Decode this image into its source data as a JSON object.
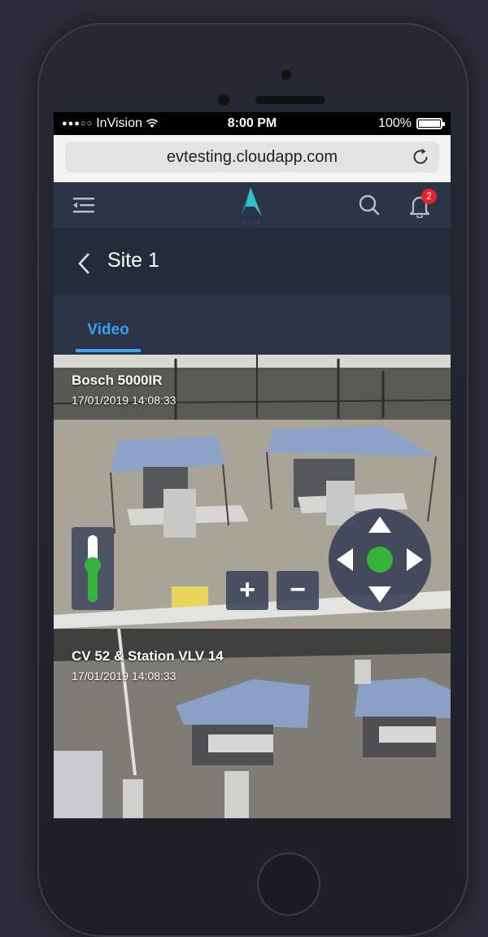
{
  "status_bar": {
    "carrier": "InVision",
    "time": "8:00 PM",
    "battery": "100%"
  },
  "browser": {
    "url": "evtesting.cloudapp.com"
  },
  "app_header": {
    "logo_text": "ALIS",
    "notification_count": "2"
  },
  "page": {
    "title": "Site 1"
  },
  "tabs": [
    {
      "label": "Video",
      "active": true
    }
  ],
  "cameras": [
    {
      "name": "Bosch 5000IR",
      "timestamp": "17/01/2019 14:08:33",
      "controls": {
        "zoom_level": 0.55,
        "zoom_in_label": "+",
        "zoom_out_label": "−"
      }
    },
    {
      "name": "CV 52 & Station VLV 14",
      "timestamp": "17/01/2019 14:08:33"
    }
  ],
  "colors": {
    "accent": "#3aa1ee",
    "header_bg": "#2a3446",
    "page_header_bg": "#232c3b",
    "control_green": "#35b43c",
    "badge_red": "#e3222a"
  }
}
